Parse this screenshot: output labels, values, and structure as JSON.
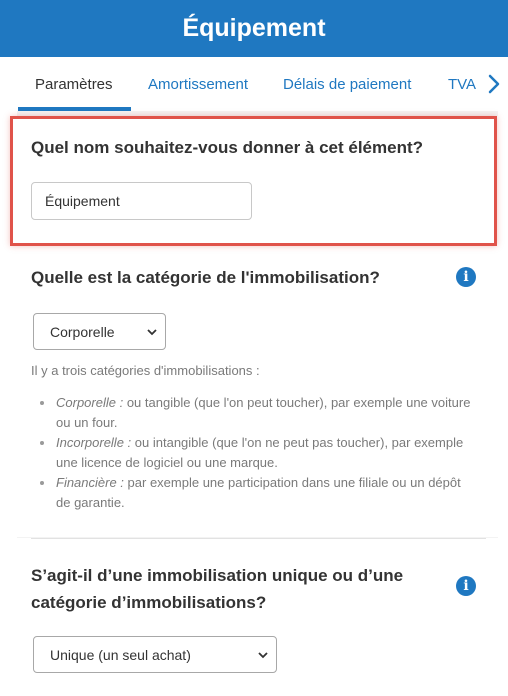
{
  "header": {
    "title": "Équipement"
  },
  "tabs": [
    {
      "label": "Paramètres"
    },
    {
      "label": "Amortissement"
    },
    {
      "label": "Délais de paiement"
    },
    {
      "label": "TVA"
    }
  ],
  "name_section": {
    "question": "Quel nom souhaitez-vous donner à cet élément?",
    "value": "Équipement"
  },
  "category_section": {
    "question": "Quelle est la catégorie de l'immobilisation?",
    "info_icon": "info-icon",
    "selected": "Corporelle",
    "help_intro": "Il y a trois catégories d'immobilisations :",
    "items": [
      {
        "term": "Corporelle :",
        "text": "ou tangible (que l'on peut toucher), par exemple une voiture ou un four."
      },
      {
        "term": "Incorporelle :",
        "text": "ou intangible (que l'on ne peut pas toucher), par exemple une licence de logiciel ou une marque."
      },
      {
        "term": "Financière :",
        "text": "par exemple une participation dans une filiale ou un dépôt de garantie."
      }
    ]
  },
  "unique_section": {
    "question_line1": "S’agit-il d’une immobilisation unique ou d’une",
    "question_line2": "catégorie d’immobilisations?",
    "info_icon": "info-icon",
    "selected": "Unique (un seul achat)"
  },
  "colors": {
    "primary": "#1f78c1",
    "highlight": "#e0534a",
    "background": "#f3f3f3"
  }
}
